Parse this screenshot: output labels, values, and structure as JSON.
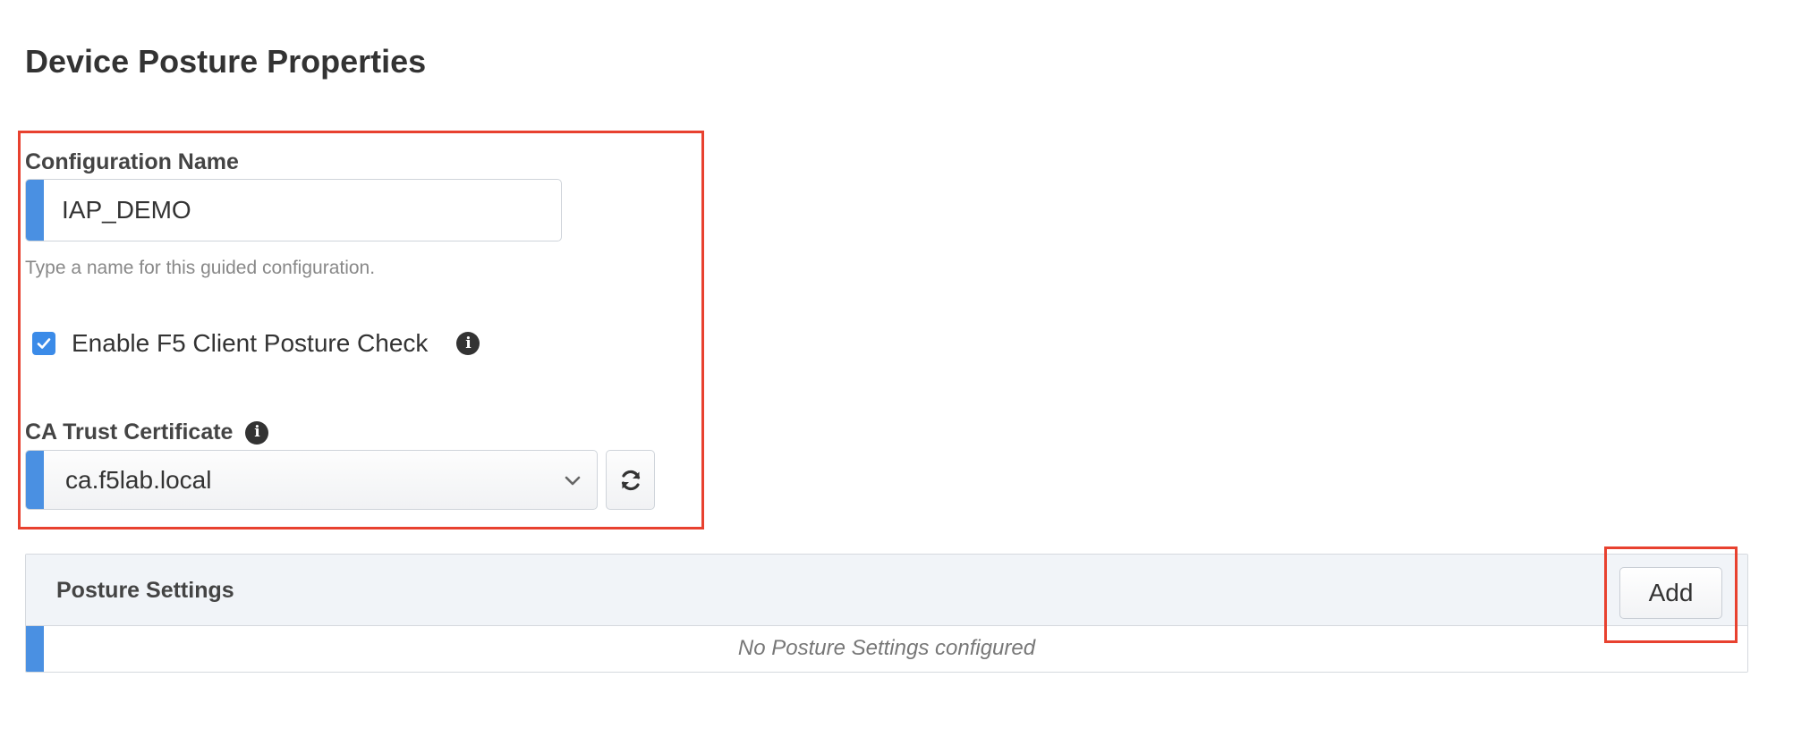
{
  "page": {
    "title": "Device Posture Properties"
  },
  "config_name": {
    "label": "Configuration Name",
    "value": "IAP_DEMO",
    "help": "Type a name for this guided configuration."
  },
  "posture_check": {
    "label": "Enable F5 Client Posture Check",
    "checked": true,
    "info_icon": "info-circle-icon"
  },
  "ca_trust": {
    "label": "CA Trust Certificate",
    "selected": "ca.f5lab.local",
    "info_icon": "info-circle-icon",
    "refresh_icon": "refresh-icon"
  },
  "posture_settings": {
    "title": "Posture Settings",
    "add_label": "Add",
    "empty_message": "No Posture Settings configured"
  },
  "colors": {
    "accent_blue": "#4a90e2",
    "highlight_red": "#e8412f",
    "panel_header_bg": "#f1f4f8"
  }
}
